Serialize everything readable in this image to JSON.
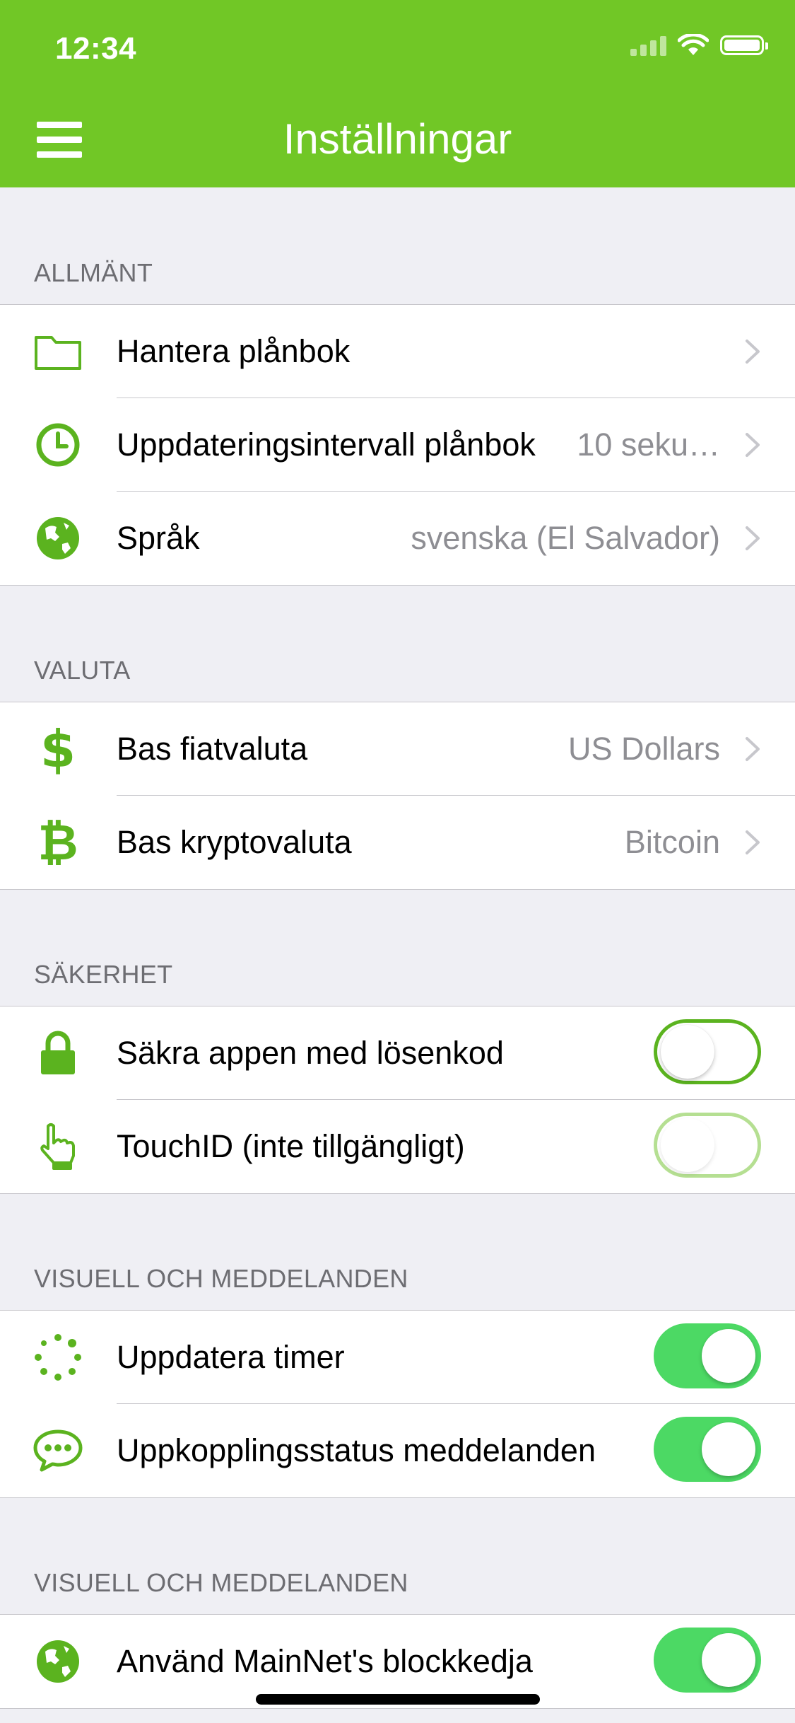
{
  "status_bar": {
    "time": "12:34"
  },
  "header": {
    "title": "Inställningar",
    "menu_icon": "hamburger-menu-icon",
    "color": "#71c726"
  },
  "sections": [
    {
      "label": "ALLMÄNT",
      "rows": [
        {
          "icon": "folder-icon",
          "label": "Hantera plånbok",
          "value": "",
          "control": "chevron"
        },
        {
          "icon": "clock-icon",
          "label": "Uppdateringsintervall plånbok",
          "value": "10 seku…",
          "control": "chevron"
        },
        {
          "icon": "globe-icon",
          "label": "Språk",
          "value": "svenska (El Salvador)",
          "control": "chevron"
        }
      ]
    },
    {
      "label": "VALUTA",
      "rows": [
        {
          "icon": "dollar-icon",
          "label": "Bas fiatvaluta",
          "value": "US Dollars",
          "control": "chevron"
        },
        {
          "icon": "bitcoin-icon",
          "label": "Bas kryptovaluta",
          "value": "Bitcoin",
          "control": "chevron"
        }
      ]
    },
    {
      "label": "SÄKERHET",
      "rows": [
        {
          "icon": "lock-icon",
          "label": "Säkra appen med lösenkod",
          "toggle": "off"
        },
        {
          "icon": "touch-hand-icon",
          "label": "TouchID (inte tillgängligt)",
          "toggle": "disabled"
        }
      ]
    },
    {
      "label": "VISUELL OCH MEDDELANDEN",
      "rows": [
        {
          "icon": "spinner-icon",
          "label": "Uppdatera timer",
          "toggle": "on"
        },
        {
          "icon": "chat-bubble-icon",
          "label": "Uppkopplingsstatus meddelanden",
          "toggle": "on"
        }
      ]
    },
    {
      "label": "VISUELL OCH MEDDELANDEN",
      "rows": [
        {
          "icon": "globe-icon",
          "label": "Använd MainNet's blockkedja",
          "toggle": "on"
        }
      ]
    }
  ],
  "colors": {
    "accent": "#5bb31f",
    "toggle_on": "#4cd964",
    "background": "#efeff4"
  }
}
